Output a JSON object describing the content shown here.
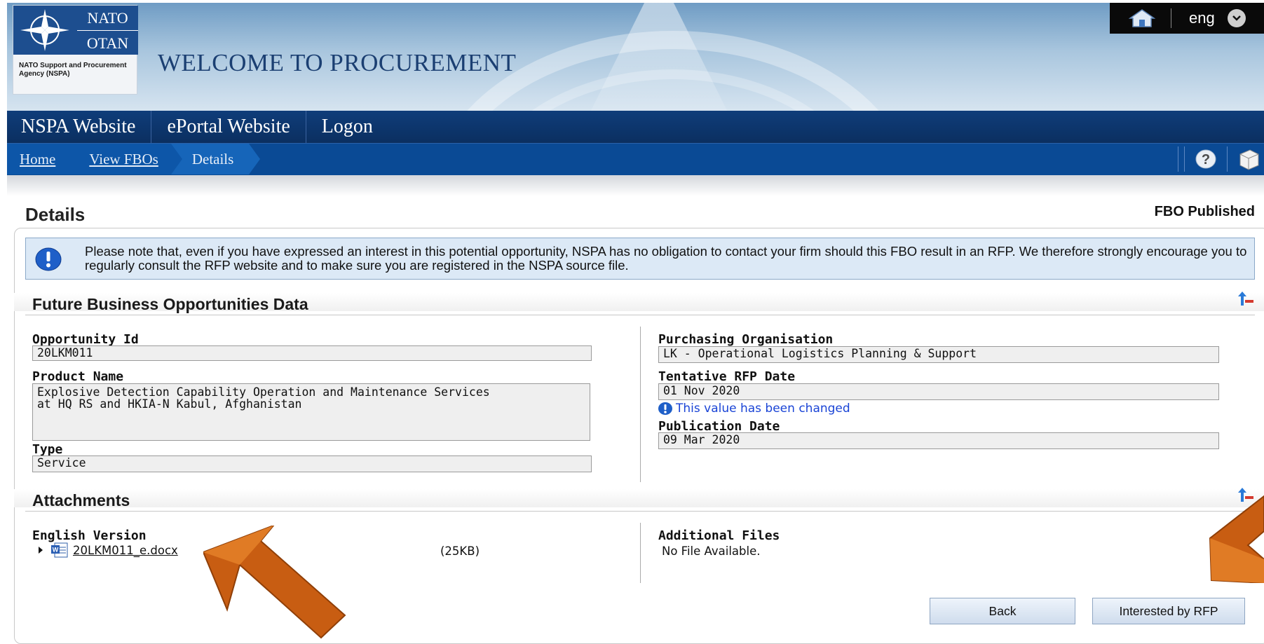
{
  "header": {
    "logo_text_top": "NATO",
    "logo_text_bottom": "OTAN",
    "logo_caption": "NATO Support and Procurement Agency (NSPA)",
    "title": "WELCOME TO PROCUREMENT",
    "language": "eng",
    "home_icon": "home-icon"
  },
  "nav": {
    "items": [
      {
        "label": "NSPA Website"
      },
      {
        "label": "ePortal Website"
      },
      {
        "label": "Logon"
      }
    ]
  },
  "breadcrumb": {
    "items": [
      {
        "label": "Home"
      },
      {
        "label": "View FBOs"
      },
      {
        "label": "Details"
      }
    ],
    "tools": [
      "help-icon",
      "export-icon"
    ]
  },
  "page": {
    "title": "Details",
    "status": "FBO Published",
    "notice": "Please note that, even if you have expressed an interest in this potential opportunity, NSPA has no obligation to contact your firm should this FBO result in an RFP. We therefore strongly encourage you to regularly consult the RFP website and to make sure you are registered in the NSPA source file."
  },
  "fbo": {
    "section_title": "Future Business Opportunities Data",
    "opportunity_id_label": "Opportunity Id",
    "opportunity_id": "20LKM011",
    "product_name_label": "Product Name",
    "product_name": "Explosive Detection Capability Operation and Maintenance Services\nat HQ RS and HKIA-N Kabul, Afghanistan",
    "type_label": "Type",
    "type": "Service",
    "purchasing_org_label": "Purchasing Organisation",
    "purchasing_org": "LK - Operational Logistics Planning & Support",
    "tentative_rfp_label": "Tentative RFP Date",
    "tentative_rfp": "01 Nov 2020",
    "changed_note": "This value has been changed",
    "publication_label": "Publication Date",
    "publication": "09 Mar 2020"
  },
  "attachments": {
    "section_title": "Attachments",
    "english_label": "English Version",
    "file_name": "20LKM011_e.docx",
    "file_size": "(25KB)",
    "additional_label": "Additional Files",
    "no_file": "No File Available."
  },
  "buttons": {
    "back": "Back",
    "interested": "Interested by RFP"
  },
  "colors": {
    "nav_bg": "#0b2f60",
    "crumb_bg": "#0a4a95",
    "notice_bg": "#dce9f6",
    "arrow": "#c35a12"
  }
}
